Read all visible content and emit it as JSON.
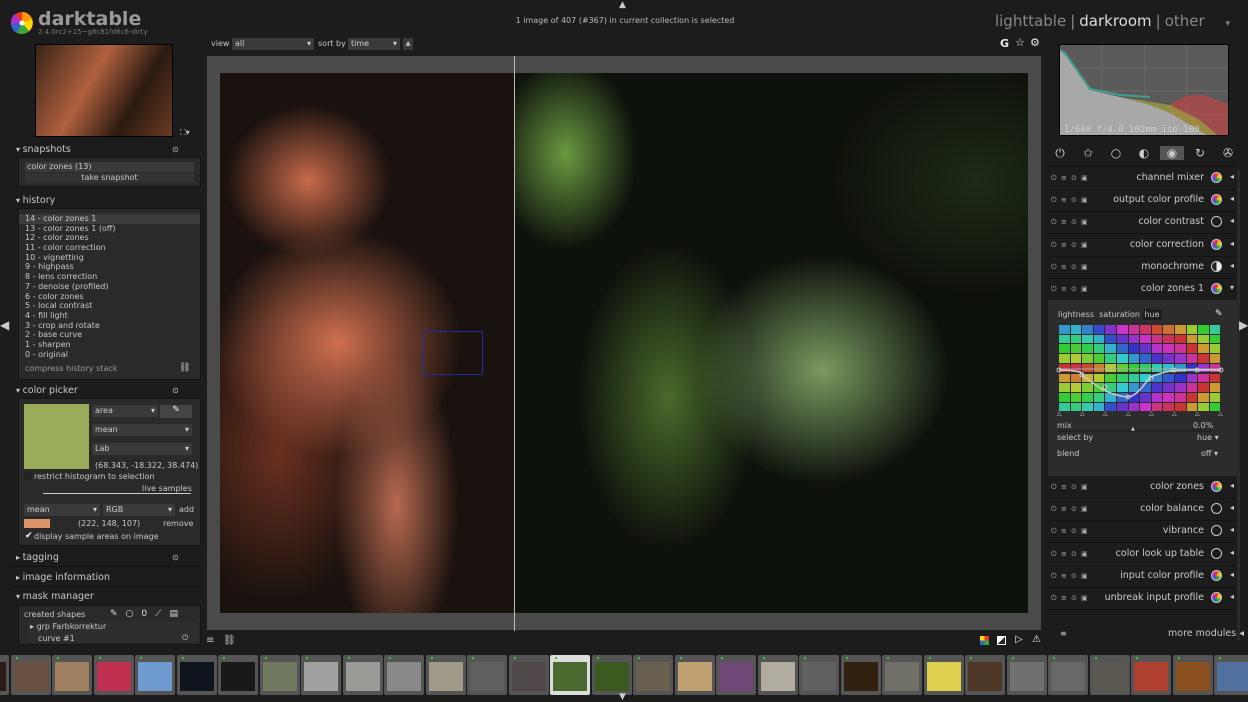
{
  "app": {
    "name": "darktable",
    "version": "2.4.0rc2+15~g8c81fd8c6-dirty"
  },
  "status": "1 image of 407 (#367) in current collection is selected",
  "views": {
    "items": [
      "lighttable",
      "darkroom",
      "other"
    ],
    "active": "darkroom",
    "separator": "|"
  },
  "topbar": {
    "view_label": "view",
    "view_value": "all",
    "sort_label": "sort by",
    "sort_value": "time",
    "icons": [
      "grouping-icon",
      "star-icon",
      "gear-icon"
    ],
    "grouping_label": "G"
  },
  "snapshots": {
    "title": "snapshots",
    "items": [
      "color zones (13)"
    ],
    "take_label": "take snapshot"
  },
  "history": {
    "title": "history",
    "items": [
      "14 - color zones 1",
      "13 - color zones 1 (off)",
      "12 - color zones",
      "11 - color correction",
      "10 - vignetting",
      "9 - highpass",
      "8 - lens correction",
      "7 - denoise (profiled)",
      "6 - color zones",
      "5 - local contrast",
      "4 - fill light",
      "3 - crop and rotate",
      "2 - base curve",
      "1 - sharpen",
      "0 - original"
    ],
    "selected": 0,
    "compress_label": "compress history stack"
  },
  "color_picker": {
    "title": "color picker",
    "swatch": "#9aab5a",
    "mode": "area",
    "stat": "mean",
    "space": "Lab",
    "values": "(68.343, -18.322, 38.474)",
    "restrict_label": "restrict histogram to selection",
    "live_label": "live samples",
    "sample_stat": "mean",
    "sample_space": "RGB",
    "add_label": "add",
    "sample_swatch": "#de946b",
    "sample_values": "(222, 148, 107)",
    "remove_label": "remove",
    "display_label": "display sample areas on image",
    "display_checked": true
  },
  "tagging": {
    "title": "tagging"
  },
  "image_information": {
    "title": "image information"
  },
  "mask_manager": {
    "title": "mask manager",
    "created_label": "created shapes",
    "items": [
      "grp Farbkorrektur",
      "curve #1"
    ]
  },
  "histogram": {
    "exif": "1/640 f/4.0 102mm iso 100"
  },
  "module_groups": [
    "power-icon",
    "favorite-icon",
    "basic-icon",
    "tone-icon",
    "color-icon",
    "correct-icon",
    "effect-icon"
  ],
  "module_groups_active": 4,
  "modules": [
    {
      "label": "channel mixer",
      "icon": "channel-mixer-icon"
    },
    {
      "label": "output color profile",
      "icon": "output-profile-icon"
    },
    {
      "label": "color contrast",
      "icon": "circle-icon"
    },
    {
      "label": "color correction",
      "icon": "color-correction-icon"
    },
    {
      "label": "monochrome",
      "icon": "half-circle-icon"
    },
    {
      "label": "color zones 1",
      "icon": "color-zones-icon",
      "expanded": true
    }
  ],
  "modules_after": [
    {
      "label": "color zones",
      "icon": "color-zones-icon"
    },
    {
      "label": "color balance",
      "icon": "circle-icon"
    },
    {
      "label": "vibrance",
      "icon": "circle-icon"
    },
    {
      "label": "color look up table",
      "icon": "circle-icon"
    },
    {
      "label": "input color profile",
      "icon": "input-profile-icon"
    },
    {
      "label": "unbreak input profile",
      "icon": "unbreak-icon"
    }
  ],
  "color_zones": {
    "tabs": [
      "lightness",
      "saturation",
      "hue"
    ],
    "active_tab": "hue",
    "mix_label": "mix",
    "mix_value": "0.0%",
    "select_label": "select by",
    "select_value": "hue",
    "blend_label": "blend",
    "blend_value": "off"
  },
  "more_modules": "more modules",
  "filmstrip": {
    "thumbs": [
      "#2a1a14",
      "#6a5040",
      "#a08060",
      "#c03050",
      "#6f9ad0",
      "#10141c",
      "#181818",
      "#707860",
      "#a0a0a0",
      "#9a9a96",
      "#888",
      "#a09a88",
      "#606060",
      "#504848",
      "#4a6a30",
      "#3a5a20",
      "#6a6050",
      "#c0a070",
      "#704878",
      "#b0aca0",
      "#606060",
      "#302010",
      "#707068",
      "#e0d050",
      "#503828",
      "#707070",
      "#686868",
      "#5a5850",
      "#b04030",
      "#8a5020",
      "#5070a0"
    ],
    "selected": 14
  }
}
